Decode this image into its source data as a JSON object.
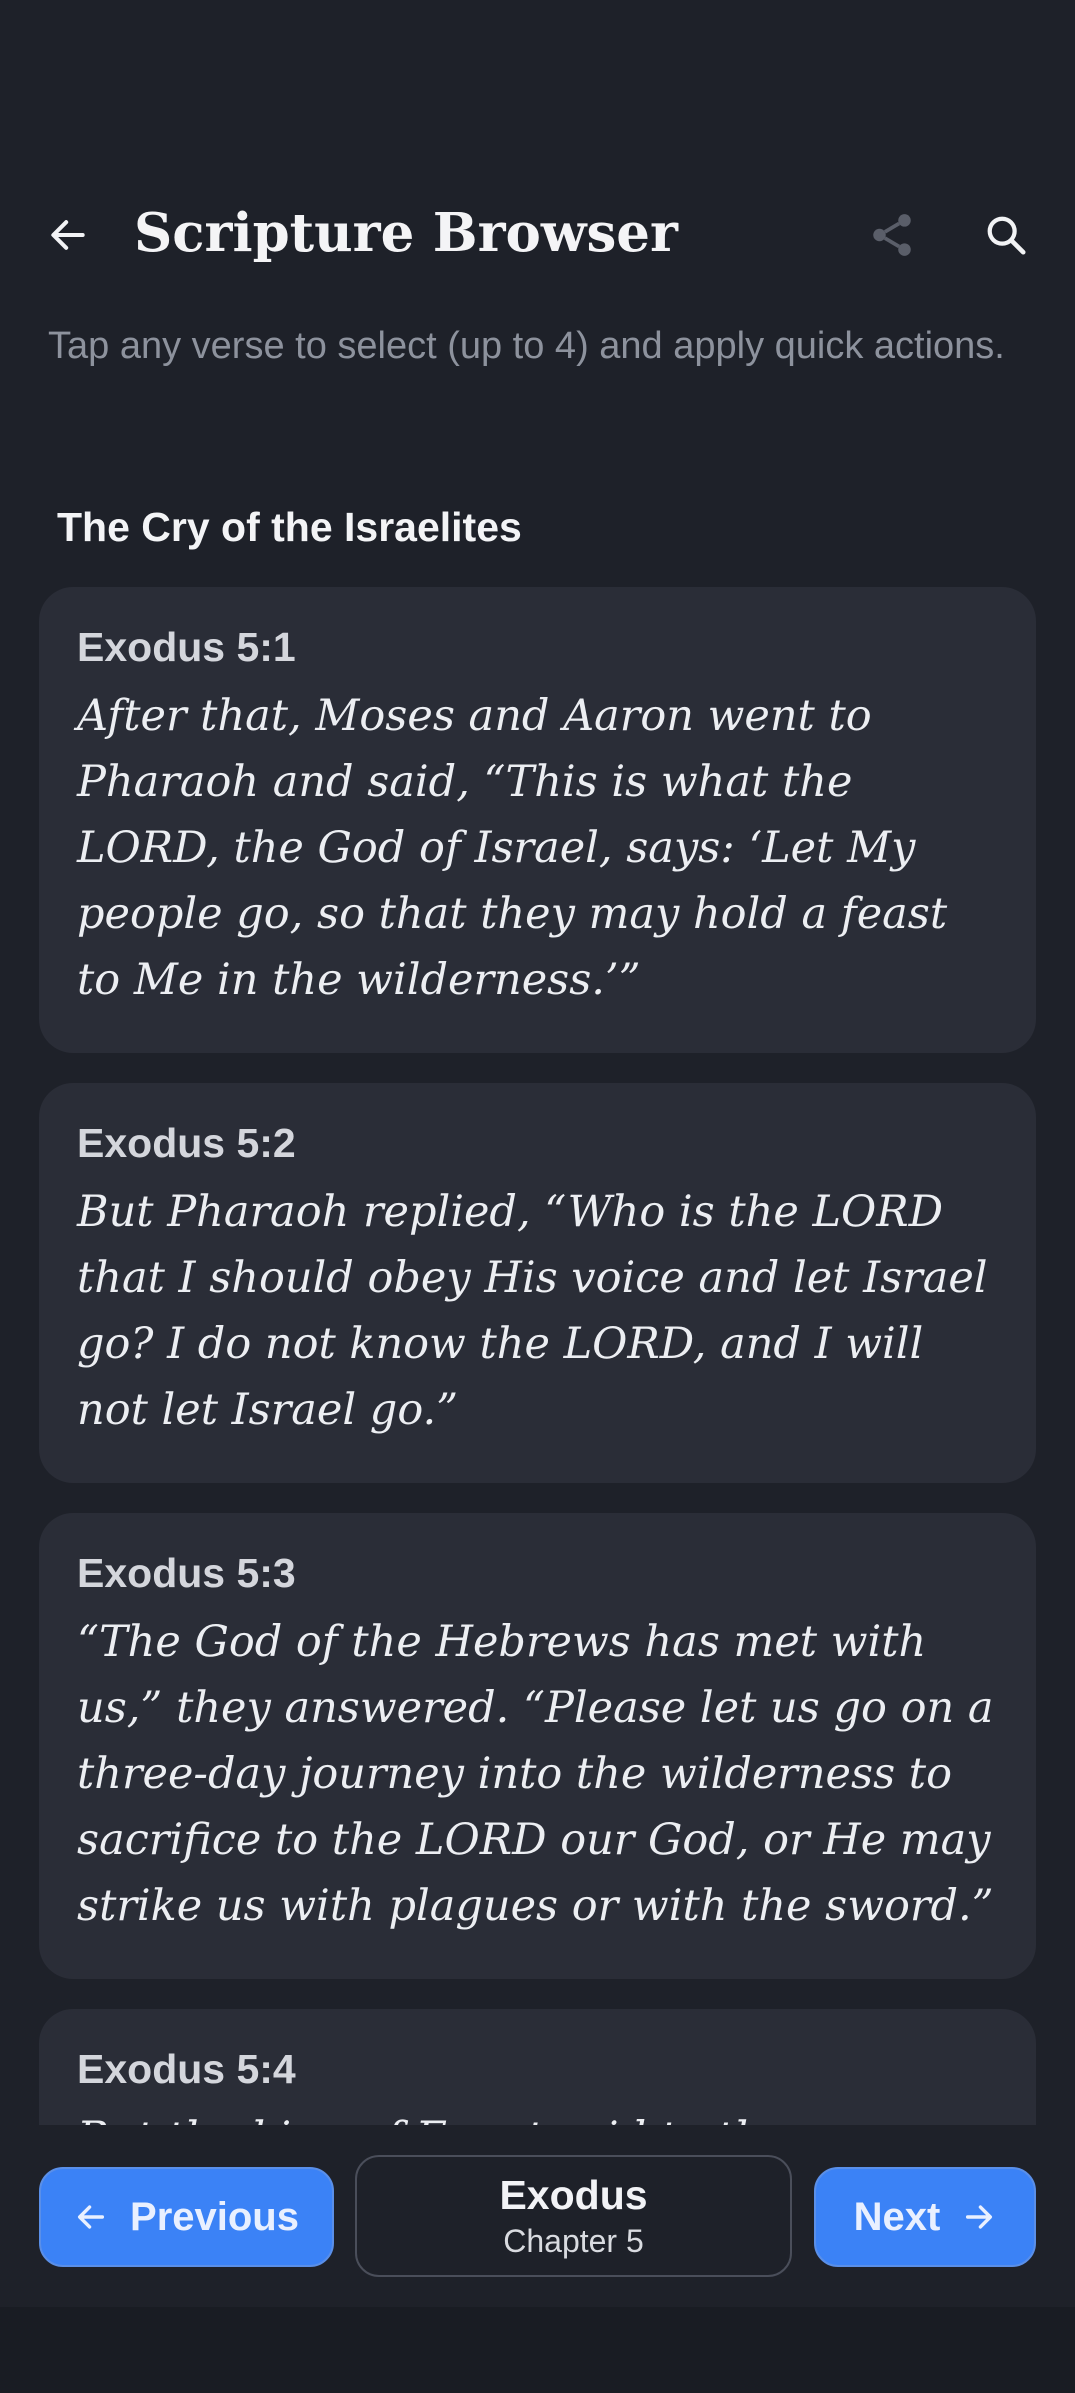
{
  "header": {
    "title": "Scripture Browser",
    "back_icon": "arrow-left-icon",
    "share_icon": "share-icon",
    "search_icon": "search-icon"
  },
  "hint": "Tap any verse to select (up to 4) and apply quick actions.",
  "section": {
    "title": "The Cry of the Israelites"
  },
  "verses": [
    {
      "ref": "Exodus 5:1",
      "text": "After that, Moses and Aaron went to Pharaoh and said, “This is what the LORD, the God of Israel, says: ‘Let My people go, so that they may hold a feast to Me in the wilderness.’”"
    },
    {
      "ref": "Exodus 5:2",
      "text": "But Pharaoh replied, “Who is the LORD that I should obey His voice and let Israel go? I do not know the LORD, and I will not let Israel go.”"
    },
    {
      "ref": "Exodus 5:3",
      "text": "“The God of the Hebrews has met with us,” they answered. “Please let us go on a three-day journey into the wilderness to sacrifice to the LORD our God, or He may strike us with plagues or with the sword.”"
    },
    {
      "ref": "Exodus 5:4",
      "text": "But the king of Egypt said to them, “Moses"
    }
  ],
  "navigation": {
    "previous_label": "Previous",
    "next_label": "Next",
    "book": "Exodus",
    "chapter": "Chapter 5"
  },
  "colors": {
    "background": "#1e2129",
    "card": "#2a2d37",
    "accent": "#3b82f6"
  }
}
